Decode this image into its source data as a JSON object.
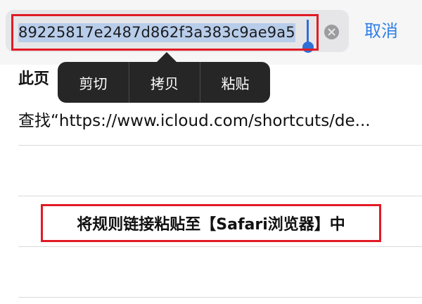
{
  "address_bar": {
    "url_text": "89225817e2487d862f3a383c9ae9a5",
    "cancel_label": "取消"
  },
  "context_menu": {
    "items": [
      {
        "label": "剪切"
      },
      {
        "label": "拷贝"
      },
      {
        "label": "粘贴"
      }
    ]
  },
  "page": {
    "section_title": "此页",
    "search_suggestion": "查找“https://www.icloud.com/shortcuts/de..."
  },
  "annotation": {
    "instruction": "将规则链接粘贴至【Safari浏览器】中",
    "highlight_color": "#e11b25"
  },
  "colors": {
    "accent": "#2f7fe6",
    "selection": "#b8cdea",
    "menu_background": "#262626"
  },
  "icons": {
    "clear": "clear-x-icon"
  }
}
